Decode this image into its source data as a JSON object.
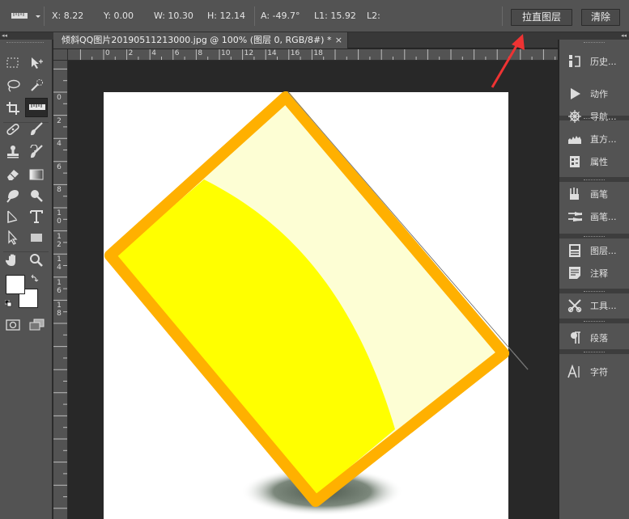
{
  "options_bar": {
    "x": "X: 8.22",
    "y": "Y: 0.00",
    "w": "W: 10.30",
    "h": "H: 12.14",
    "a": "A: -49.7°",
    "l1": "L1: 15.92",
    "l2": "L2:",
    "straighten_button": "拉直图层",
    "clear_button": "清除"
  },
  "collapse_marks": {
    "left": "◂◂",
    "right": "◂◂"
  },
  "document_tab": {
    "title": "倾斜QQ图片20190511213000.jpg @ 100% (图层 0, RGB/8#) *",
    "close": "×"
  },
  "ruler": {
    "horizontal_labels": [
      "0",
      "2",
      "4",
      "6",
      "8",
      "10",
      "12",
      "14",
      "16",
      "18"
    ],
    "vertical_labels": [
      [
        "0"
      ],
      [
        "2"
      ],
      [
        "4"
      ],
      [
        "6"
      ],
      [
        "8"
      ],
      [
        "1",
        "0"
      ],
      [
        "1",
        "2"
      ],
      [
        "1",
        "4"
      ],
      [
        "1",
        "6"
      ],
      [
        "1",
        "8"
      ]
    ]
  },
  "right_panels": [
    {
      "label": "历史...",
      "icon": "history-icon"
    },
    {
      "label": "动作",
      "icon": "actions-icon"
    },
    {
      "label": "导航...",
      "icon": "navigator-icon"
    },
    {
      "label": "直方...",
      "icon": "histogram-icon"
    },
    {
      "label": "属性",
      "icon": "properties-icon"
    },
    {
      "label": "画笔",
      "icon": "brush-icon"
    },
    {
      "label": "画笔...",
      "icon": "brush-presets-icon"
    },
    {
      "label": "图层...",
      "icon": "layer-comps-icon"
    },
    {
      "label": "注释",
      "icon": "notes-icon"
    },
    {
      "label": "工具...",
      "icon": "tool-presets-icon"
    },
    {
      "label": "段落",
      "icon": "paragraph-icon"
    },
    {
      "label": "字符",
      "icon": "character-icon"
    }
  ],
  "colors": {
    "card_border": "#ffb000",
    "card_fill": "#fdfed4",
    "card_yellow": "#ffff00",
    "annotation_arrow": "#ee3333",
    "ui_panel": "#535353",
    "ui_dark": "#282828"
  }
}
